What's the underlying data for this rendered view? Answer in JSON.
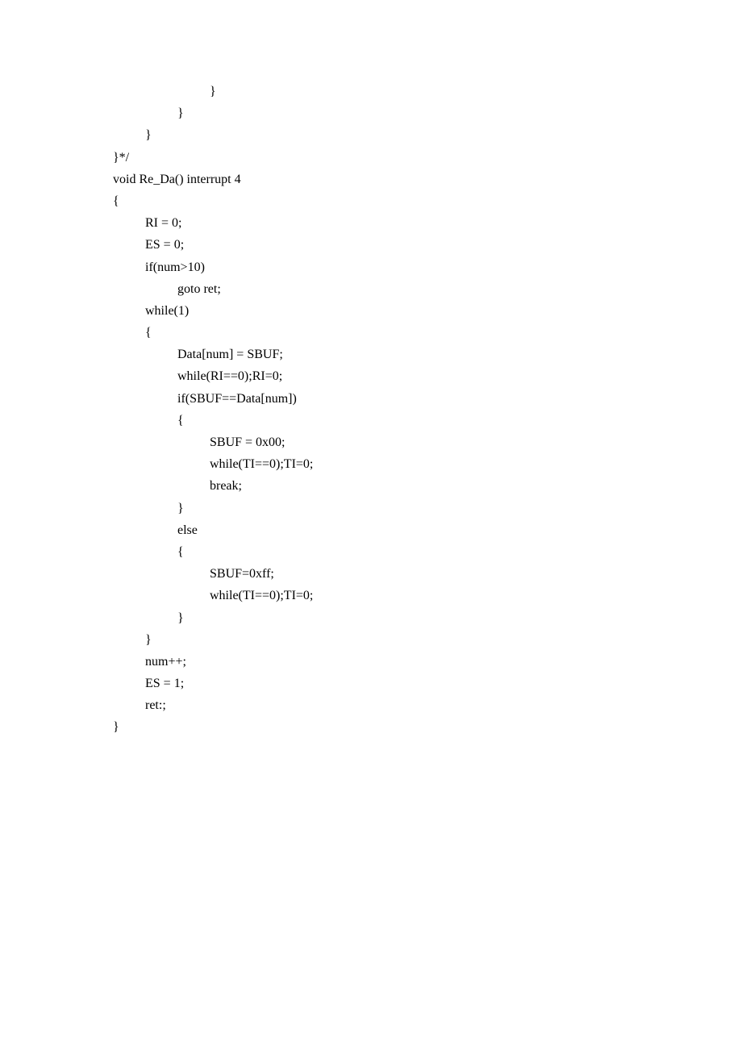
{
  "code": {
    "lines": [
      {
        "indent": 3,
        "text": "}"
      },
      {
        "indent": 2,
        "text": "}"
      },
      {
        "indent": 1,
        "text": "}"
      },
      {
        "indent": 0,
        "text": "}*/"
      },
      {
        "indent": 0,
        "text": "void Re_Da() interrupt 4"
      },
      {
        "indent": 0,
        "text": "{"
      },
      {
        "indent": 1,
        "text": "RI = 0;"
      },
      {
        "indent": 1,
        "text": "ES = 0;"
      },
      {
        "indent": 1,
        "text": "if(num>10)"
      },
      {
        "indent": 2,
        "text": "goto ret;"
      },
      {
        "indent": 1,
        "text": "while(1)"
      },
      {
        "indent": 1,
        "text": "{"
      },
      {
        "indent": 2,
        "text": "Data[num] = SBUF;"
      },
      {
        "indent": 2,
        "text": "while(RI==0);RI=0;"
      },
      {
        "indent": 2,
        "text": "if(SBUF==Data[num])"
      },
      {
        "indent": 2,
        "text": "{"
      },
      {
        "indent": 3,
        "text": "SBUF = 0x00;"
      },
      {
        "indent": 3,
        "text": "while(TI==0);TI=0;"
      },
      {
        "indent": 3,
        "text": "break;"
      },
      {
        "indent": 2,
        "text": "}"
      },
      {
        "indent": 2,
        "text": "else"
      },
      {
        "indent": 2,
        "text": "{"
      },
      {
        "indent": 3,
        "text": "SBUF=0xff;"
      },
      {
        "indent": 3,
        "text": "while(TI==0);TI=0;"
      },
      {
        "indent": 2,
        "text": "}"
      },
      {
        "indent": 1,
        "text": "}"
      },
      {
        "indent": 1,
        "text": "num++;"
      },
      {
        "indent": 1,
        "text": "ES = 1;"
      },
      {
        "indent": 1,
        "text": "ret:;"
      },
      {
        "indent": 0,
        "text": "}"
      }
    ]
  }
}
